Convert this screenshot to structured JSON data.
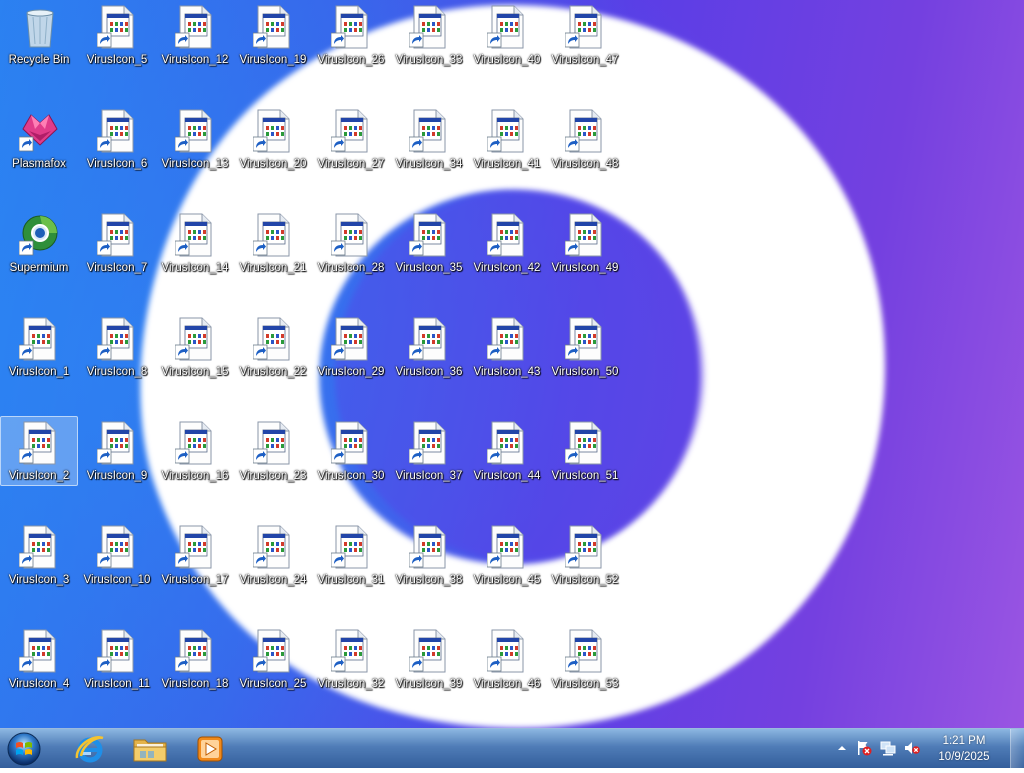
{
  "desktop": {
    "icons": [
      {
        "label": "Recycle Bin",
        "type": "recycle-bin"
      },
      {
        "label": "Plasmafox",
        "type": "plasmafox"
      },
      {
        "label": "Supermium",
        "type": "supermium"
      },
      {
        "label": "VirusIcon_1",
        "type": "virus"
      },
      {
        "label": "VirusIcon_2",
        "type": "virus",
        "selected": true
      },
      {
        "label": "VirusIcon_3",
        "type": "virus"
      },
      {
        "label": "VirusIcon_4",
        "type": "virus"
      },
      {
        "label": "VirusIcon_5",
        "type": "virus"
      },
      {
        "label": "VirusIcon_6",
        "type": "virus"
      },
      {
        "label": "VirusIcon_7",
        "type": "virus"
      },
      {
        "label": "VirusIcon_8",
        "type": "virus"
      },
      {
        "label": "VirusIcon_9",
        "type": "virus"
      },
      {
        "label": "VirusIcon_10",
        "type": "virus"
      },
      {
        "label": "VirusIcon_11",
        "type": "virus"
      },
      {
        "label": "VirusIcon_12",
        "type": "virus"
      },
      {
        "label": "VirusIcon_13",
        "type": "virus"
      },
      {
        "label": "VirusIcon_14",
        "type": "virus"
      },
      {
        "label": "VirusIcon_15",
        "type": "virus"
      },
      {
        "label": "VirusIcon_16",
        "type": "virus"
      },
      {
        "label": "VirusIcon_17",
        "type": "virus"
      },
      {
        "label": "VirusIcon_18",
        "type": "virus"
      },
      {
        "label": "VirusIcon_19",
        "type": "virus"
      },
      {
        "label": "VirusIcon_20",
        "type": "virus"
      },
      {
        "label": "VirusIcon_21",
        "type": "virus"
      },
      {
        "label": "VirusIcon_22",
        "type": "virus"
      },
      {
        "label": "VirusIcon_23",
        "type": "virus"
      },
      {
        "label": "VirusIcon_24",
        "type": "virus"
      },
      {
        "label": "VirusIcon_25",
        "type": "virus"
      },
      {
        "label": "VirusIcon_26",
        "type": "virus"
      },
      {
        "label": "VirusIcon_27",
        "type": "virus"
      },
      {
        "label": "VirusIcon_28",
        "type": "virus"
      },
      {
        "label": "VirusIcon_29",
        "type": "virus"
      },
      {
        "label": "VirusIcon_30",
        "type": "virus"
      },
      {
        "label": "VirusIcon_31",
        "type": "virus"
      },
      {
        "label": "VirusIcon_32",
        "type": "virus"
      },
      {
        "label": "VirusIcon_33",
        "type": "virus"
      },
      {
        "label": "VirusIcon_34",
        "type": "virus"
      },
      {
        "label": "VirusIcon_35",
        "type": "virus"
      },
      {
        "label": "VirusIcon_36",
        "type": "virus"
      },
      {
        "label": "VirusIcon_37",
        "type": "virus"
      },
      {
        "label": "VirusIcon_38",
        "type": "virus"
      },
      {
        "label": "VirusIcon_39",
        "type": "virus"
      },
      {
        "label": "VirusIcon_40",
        "type": "virus"
      },
      {
        "label": "VirusIcon_41",
        "type": "virus"
      },
      {
        "label": "VirusIcon_42",
        "type": "virus"
      },
      {
        "label": "VirusIcon_43",
        "type": "virus"
      },
      {
        "label": "VirusIcon_44",
        "type": "virus"
      },
      {
        "label": "VirusIcon_45",
        "type": "virus"
      },
      {
        "label": "VirusIcon_46",
        "type": "virus"
      },
      {
        "label": "VirusIcon_47",
        "type": "virus"
      },
      {
        "label": "VirusIcon_48",
        "type": "virus"
      },
      {
        "label": "VirusIcon_49",
        "type": "virus"
      },
      {
        "label": "VirusIcon_50",
        "type": "virus"
      },
      {
        "label": "VirusIcon_51",
        "type": "virus"
      },
      {
        "label": "VirusIcon_52",
        "type": "virus"
      },
      {
        "label": "VirusIcon_53",
        "type": "virus"
      }
    ]
  },
  "taskbar": {
    "start_icon": "windows-orb-icon",
    "pinned": [
      {
        "name": "internet-explorer",
        "icon": "internet-explorer-icon"
      },
      {
        "name": "windows-explorer",
        "icon": "folder-icon"
      },
      {
        "name": "media-player",
        "icon": "media-player-icon"
      }
    ],
    "tray": {
      "icons": [
        "show-hidden-icons-chevron",
        "action-center-flag-icon",
        "network-icon",
        "volume-muted-icon"
      ],
      "time": "1:21 PM",
      "date": "10/9/2025"
    }
  },
  "colors": {
    "wallpaper_left": "#2b7ff0",
    "wallpaper_right": "#9a55e2",
    "wallpaper_ring": "#ffffff",
    "taskbar": "#3c6eaf"
  }
}
